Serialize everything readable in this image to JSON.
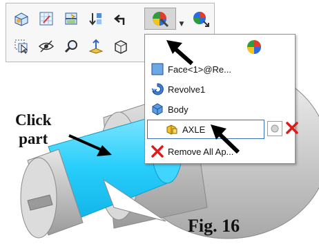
{
  "menu": {
    "items": [
      {
        "label": "Face<1>@Re...",
        "icon": "face-icon"
      },
      {
        "label": "Revolve1",
        "icon": "revolve-feature-icon"
      },
      {
        "label": "Body",
        "icon": "body-icon"
      },
      {
        "label": "AXLE",
        "icon": "part-icon",
        "selected": true
      },
      {
        "label": "Remove All Ap...",
        "icon": "red-x-icon"
      }
    ]
  },
  "callout": {
    "line1": "Click",
    "line2": "part"
  },
  "figure": {
    "caption": "Fig. 16"
  },
  "colors": {
    "part_highlight": "#27cdfb",
    "selection_border": "#3a6fc0",
    "remove_red": "#e01919"
  }
}
